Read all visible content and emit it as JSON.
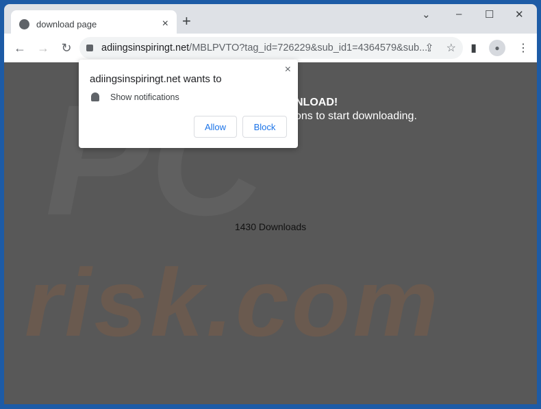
{
  "tab": {
    "title": "download page",
    "close": "×",
    "new_tab": "+"
  },
  "window_controls": {
    "list": "⌄",
    "minimize": "–",
    "maximize": "☐",
    "close": "✕"
  },
  "toolbar": {
    "back": "←",
    "forward": "→",
    "reload": "↻",
    "url_domain": "adiingsinspiringt.net",
    "url_path": "/MBLPVTO?tag_id=726229&sub_id1=4364579&sub...",
    "share": "⇪",
    "star": "☆",
    "sidepanel": "▮",
    "menu": "⋮"
  },
  "popup": {
    "title": "adiingsinspiringt.net wants to",
    "permission": "Show notifications",
    "allow": "Allow",
    "block": "Block",
    "close": "×"
  },
  "page": {
    "heading": "NLOAD!",
    "subheading": "ons to start downloading.",
    "downloads": "1430 Downloads"
  },
  "watermark": "risk.com",
  "watermark_logo": "PC"
}
